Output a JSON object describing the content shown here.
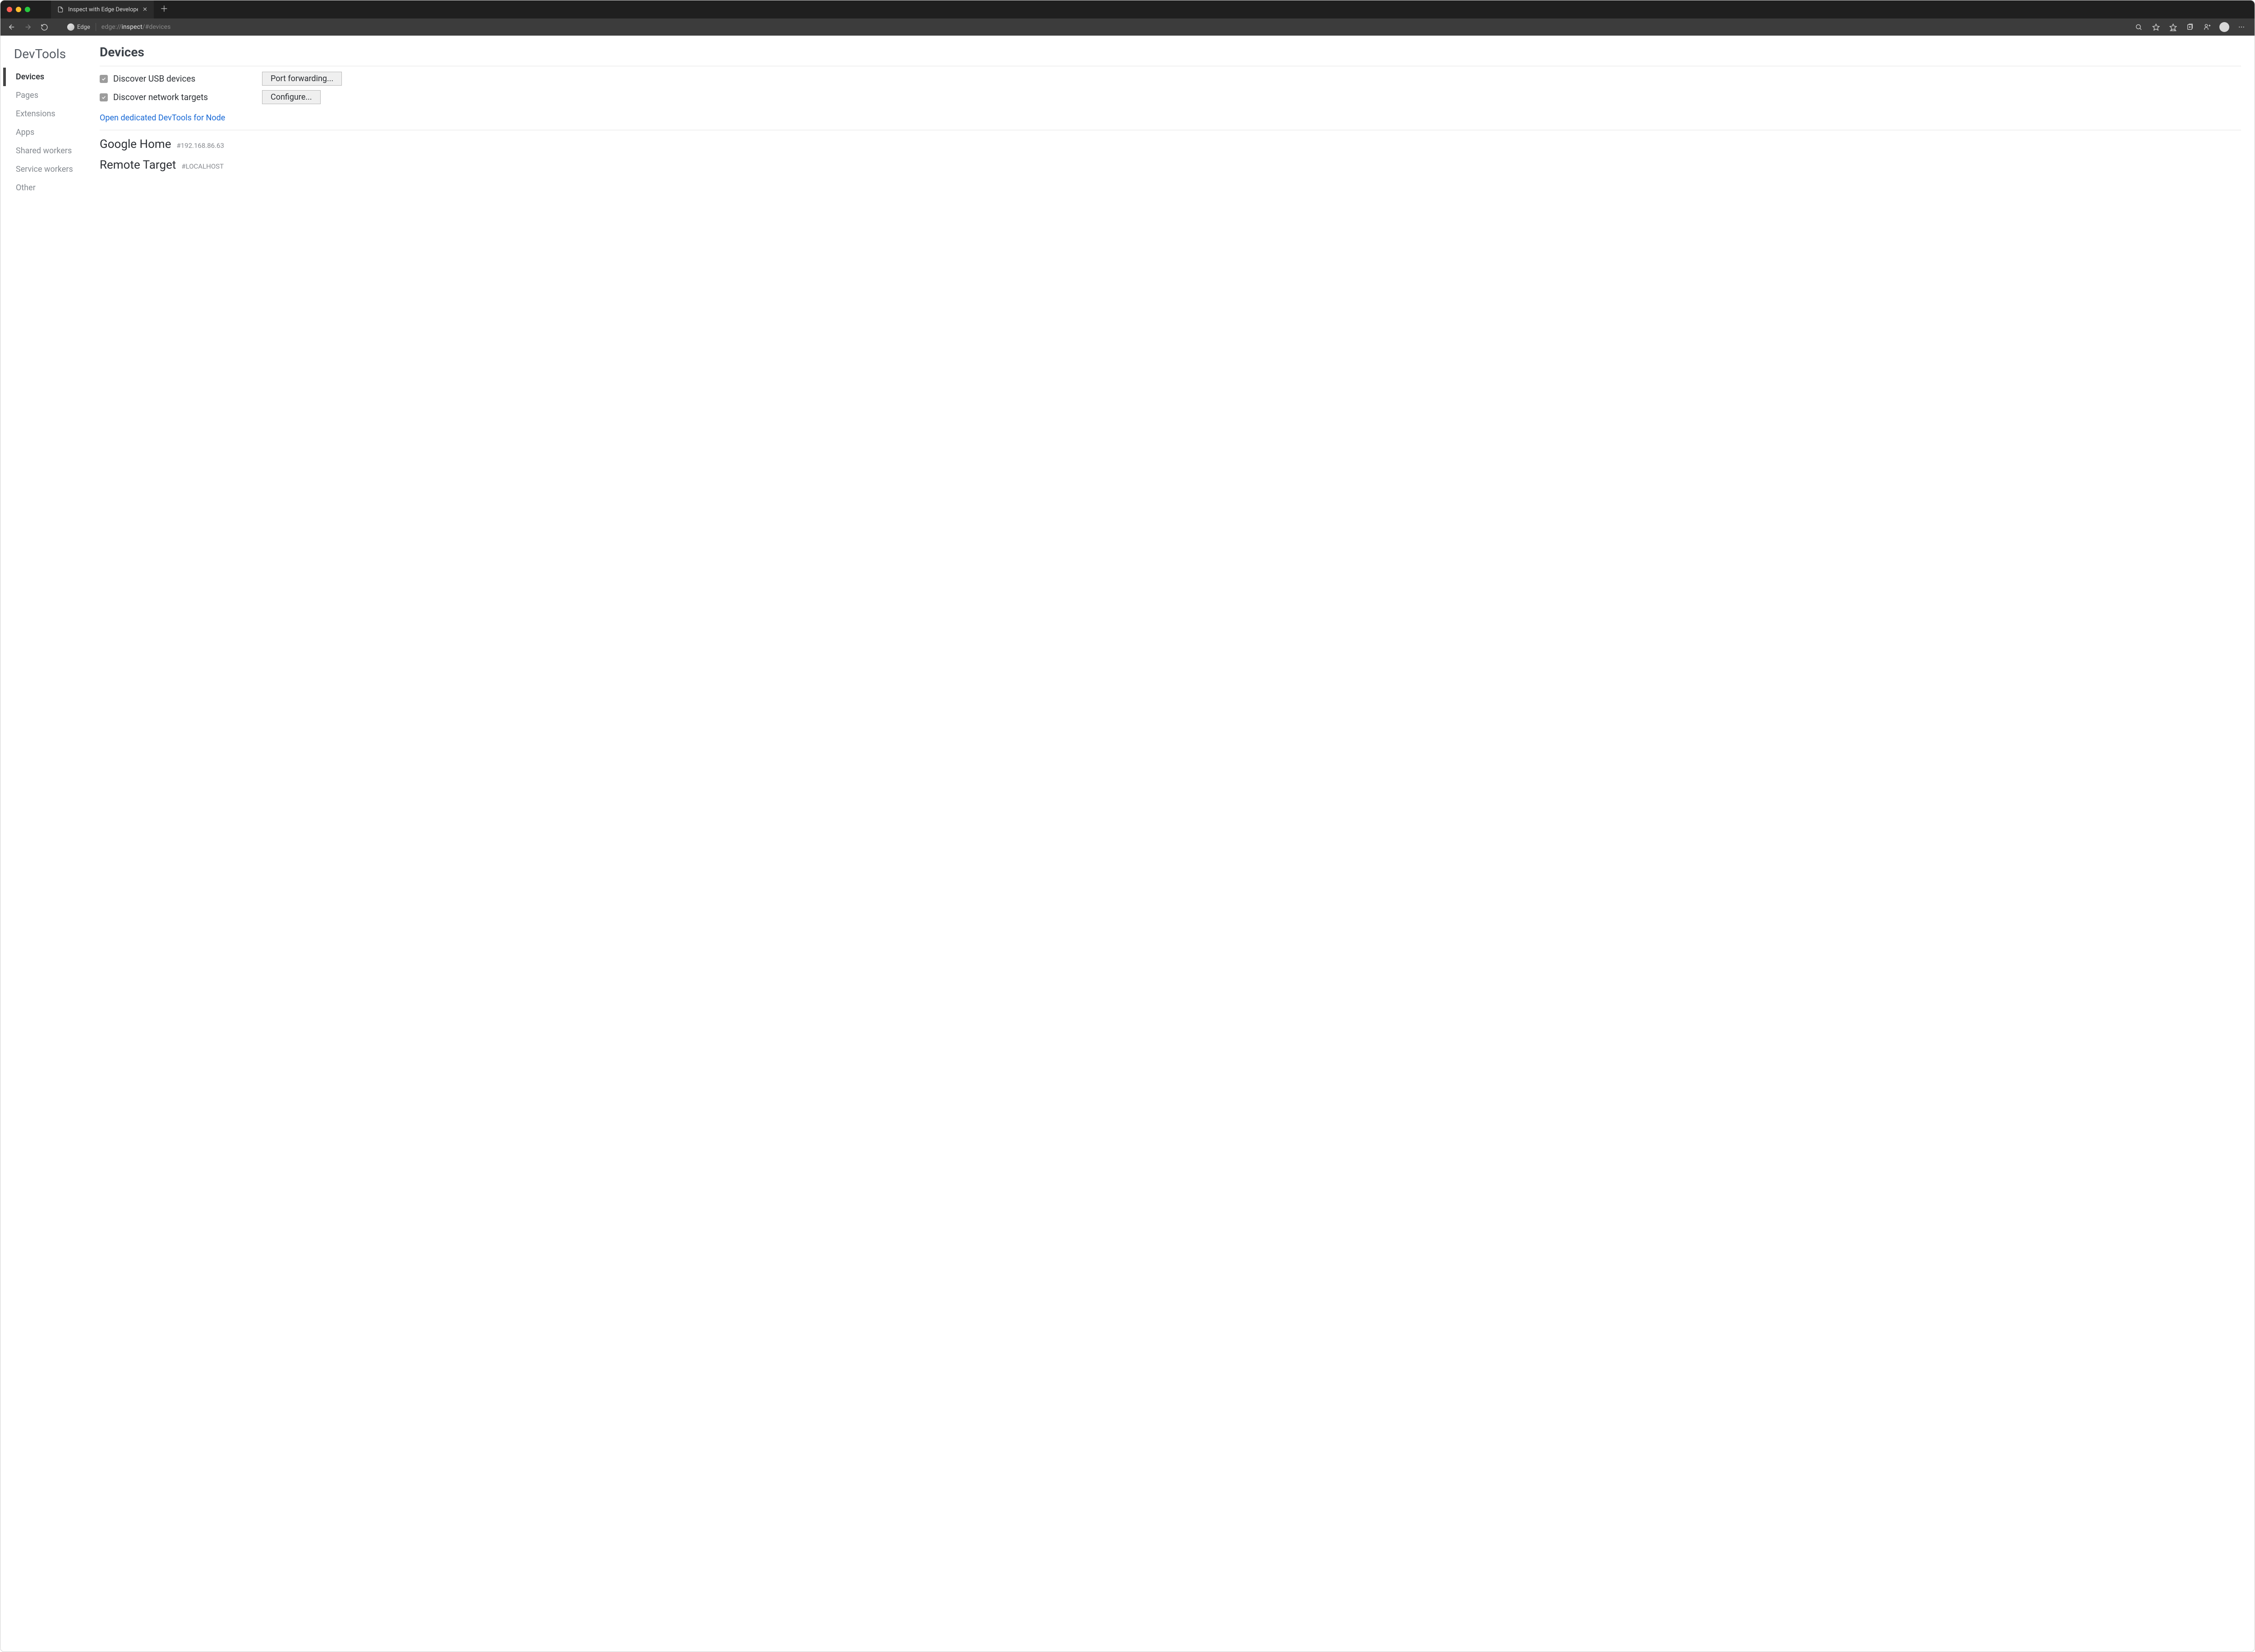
{
  "tab": {
    "title": "Inspect with Edge Developer T"
  },
  "address": {
    "badge_label": "Edge",
    "url_dim_prefix": "edge://",
    "url_bright": "inspect",
    "url_dim_suffix": "/#devices"
  },
  "sidebar": {
    "brand": "DevTools",
    "items": [
      {
        "label": "Devices",
        "active": true
      },
      {
        "label": "Pages",
        "active": false
      },
      {
        "label": "Extensions",
        "active": false
      },
      {
        "label": "Apps",
        "active": false
      },
      {
        "label": "Shared workers",
        "active": false
      },
      {
        "label": "Service workers",
        "active": false
      },
      {
        "label": "Other",
        "active": false
      }
    ]
  },
  "main": {
    "title": "Devices",
    "options": [
      {
        "label": "Discover USB devices",
        "checked": true,
        "button": "Port forwarding..."
      },
      {
        "label": "Discover network targets",
        "checked": true,
        "button": "Configure..."
      }
    ],
    "node_link": "Open dedicated DevTools for Node",
    "targets": [
      {
        "name": "Google Home",
        "hash": "#192.168.86.63"
      },
      {
        "name": "Remote Target",
        "hash": "#LOCALHOST"
      }
    ]
  }
}
